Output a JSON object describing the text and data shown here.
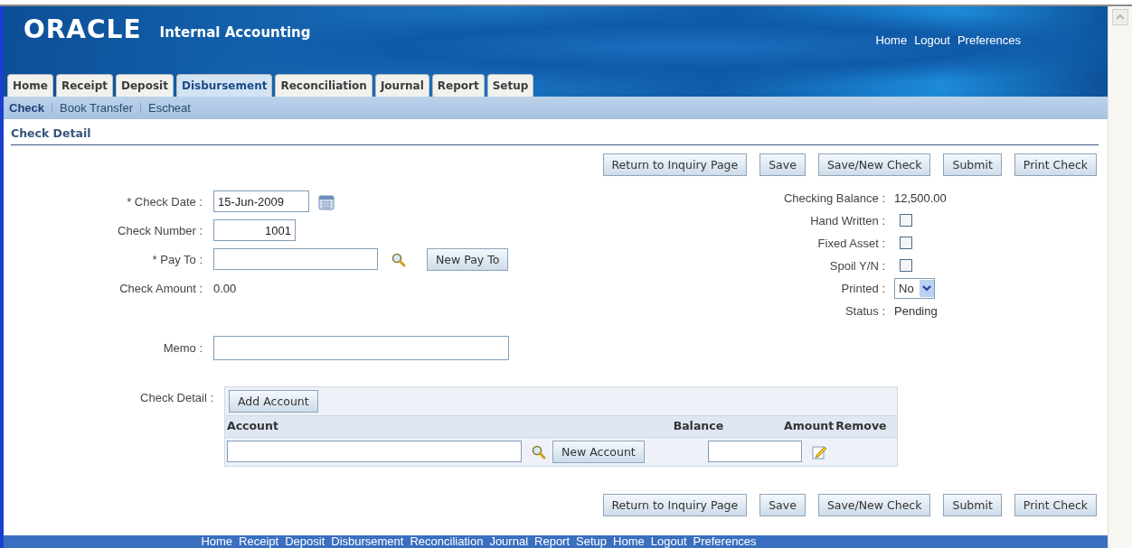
{
  "header": {
    "logo": "ORACLE",
    "app_title": "Internal Accounting",
    "global_links": [
      "Home",
      "Logout",
      "Preferences"
    ]
  },
  "tabs": [
    {
      "label": "Home",
      "selected": false
    },
    {
      "label": "Receipt",
      "selected": false
    },
    {
      "label": "Deposit",
      "selected": false
    },
    {
      "label": "Disbursement",
      "selected": true
    },
    {
      "label": "Reconciliation",
      "selected": false
    },
    {
      "label": "Journal",
      "selected": false
    },
    {
      "label": "Report",
      "selected": false
    },
    {
      "label": "Setup",
      "selected": false
    }
  ],
  "subtabs": [
    {
      "label": "Check",
      "selected": true
    },
    {
      "label": "Book Transfer",
      "selected": false
    },
    {
      "label": "Escheat",
      "selected": false
    }
  ],
  "page_title": "Check Detail",
  "top_buttons": [
    "Return to Inquiry Page",
    "Save",
    "Save/New Check",
    "Submit",
    "Print Check"
  ],
  "left_fields": [
    {
      "kind": "date",
      "label": "* Check Date :",
      "value": "15-Jun-2009"
    },
    {
      "kind": "number",
      "label": "Check Number :",
      "value": "1001"
    },
    {
      "kind": "lookup",
      "label": "* Pay To :",
      "button": "New Pay To"
    },
    {
      "kind": "text",
      "label": "Check Amount :",
      "value": "0.00"
    }
  ],
  "memo": {
    "label": "Memo :"
  },
  "right_fields": [
    {
      "kind": "text",
      "label": "Checking Balance :",
      "value": "12,500.00"
    },
    {
      "kind": "checkbox",
      "label": "Hand Written :",
      "checked": false
    },
    {
      "kind": "checkbox",
      "label": "Fixed Asset :",
      "checked": false
    },
    {
      "kind": "checkbox",
      "label": "Spoil Y/N :",
      "checked": false
    },
    {
      "kind": "select",
      "label": "Printed :",
      "value": "No"
    },
    {
      "kind": "text",
      "label": "Status :",
      "value": "Pending"
    }
  ],
  "check_detail": {
    "label": "Check Detail :",
    "add_button": "Add Account",
    "columns": [
      "Account",
      "Balance",
      "Amount",
      "Remove"
    ],
    "new_account_button": "New Account"
  },
  "bottom_buttons": [
    "Return to Inquiry Page",
    "Save",
    "Save/New Check",
    "Submit",
    "Print Check"
  ],
  "footer_links": [
    "Home",
    "Receipt",
    "Deposit",
    "Disbursement",
    "Reconciliation",
    "Journal",
    "Report",
    "Setup",
    "Home",
    "Logout",
    "Preferences"
  ]
}
